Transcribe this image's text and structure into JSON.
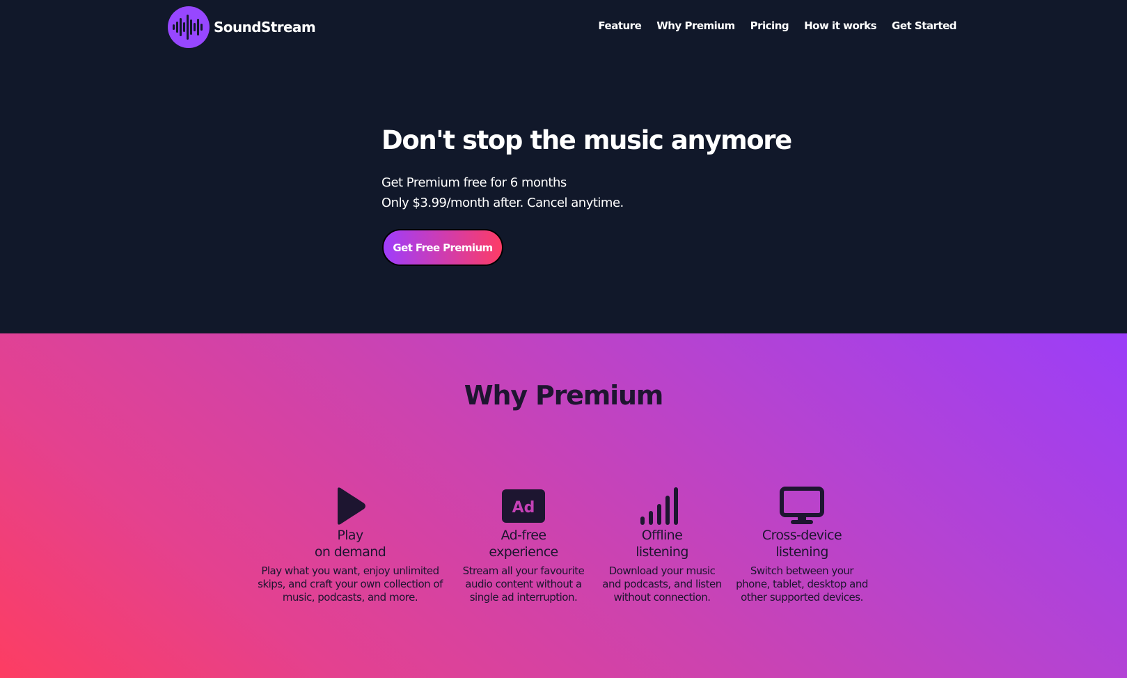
{
  "brand": {
    "name": "SoundStream",
    "logo_color": "#9747ff"
  },
  "nav": {
    "items": [
      "Feature",
      "Why Premium",
      "Pricing",
      "How it works",
      "Get Started"
    ]
  },
  "hero": {
    "title": "Don't stop the music anymore",
    "subtitle_line1": "Get Premium free for 6 months",
    "subtitle_line2": "Only $3.99/month after. Cancel anytime.",
    "cta_label": "Get Free Premium",
    "background": "#11182a"
  },
  "premium": {
    "title": "Why Premium",
    "features": [
      {
        "icon": "play-icon",
        "title_line1": "Play",
        "title_line2": "on demand",
        "desc": [
          "Play what you want, enjoy unlimited",
          "skips, and craft your own collection of",
          "music, podcasts, and more."
        ]
      },
      {
        "icon": "ad-icon",
        "title_line1": "Ad-free",
        "title_line2": "experience",
        "desc": [
          "Stream all your favourite",
          "audio content without a",
          "single ad interruption."
        ]
      },
      {
        "icon": "signal-bars-icon",
        "title_line1": "Offline",
        "title_line2": "listening",
        "desc": [
          "Download your music",
          "and podcasts, and listen",
          "without connection."
        ]
      },
      {
        "icon": "desktop-icon",
        "title_line1": "Cross-device",
        "title_line2": "listening",
        "desc": [
          "Switch between your",
          "phone, tablet, desktop and",
          "other supported devices."
        ]
      }
    ]
  },
  "colors": {
    "gradient_start": "#fd3d62",
    "gradient_end": "#9b3ef8",
    "text_dark": "#1d1530"
  }
}
